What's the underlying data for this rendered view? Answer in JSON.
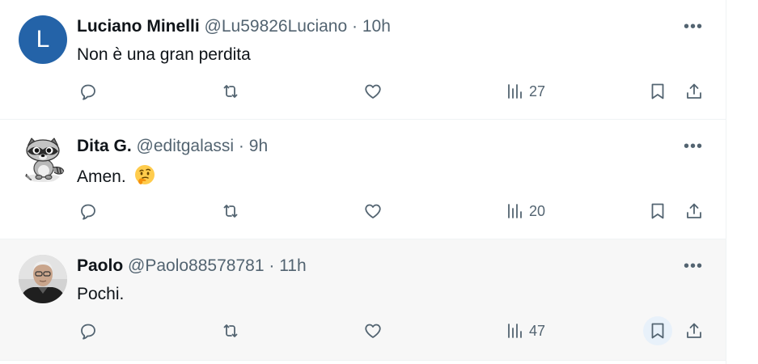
{
  "tweets": [
    {
      "avatar_letter": "L",
      "display_name": "Luciano Minelli",
      "handle": "@Lu59826Luciano",
      "time": "10h",
      "text": "Non è una gran perdita",
      "views": "27"
    },
    {
      "display_name": "Dita G.",
      "handle": "@editgalassi",
      "time": "9h",
      "text": "Amen.",
      "emoji": "thinking-face",
      "views": "20"
    },
    {
      "display_name": "Paolo",
      "handle": "@Paolo88578781",
      "time": "11h",
      "text": "Pochi.",
      "views": "47"
    }
  ],
  "separator": "·",
  "more_glyph": "•••"
}
